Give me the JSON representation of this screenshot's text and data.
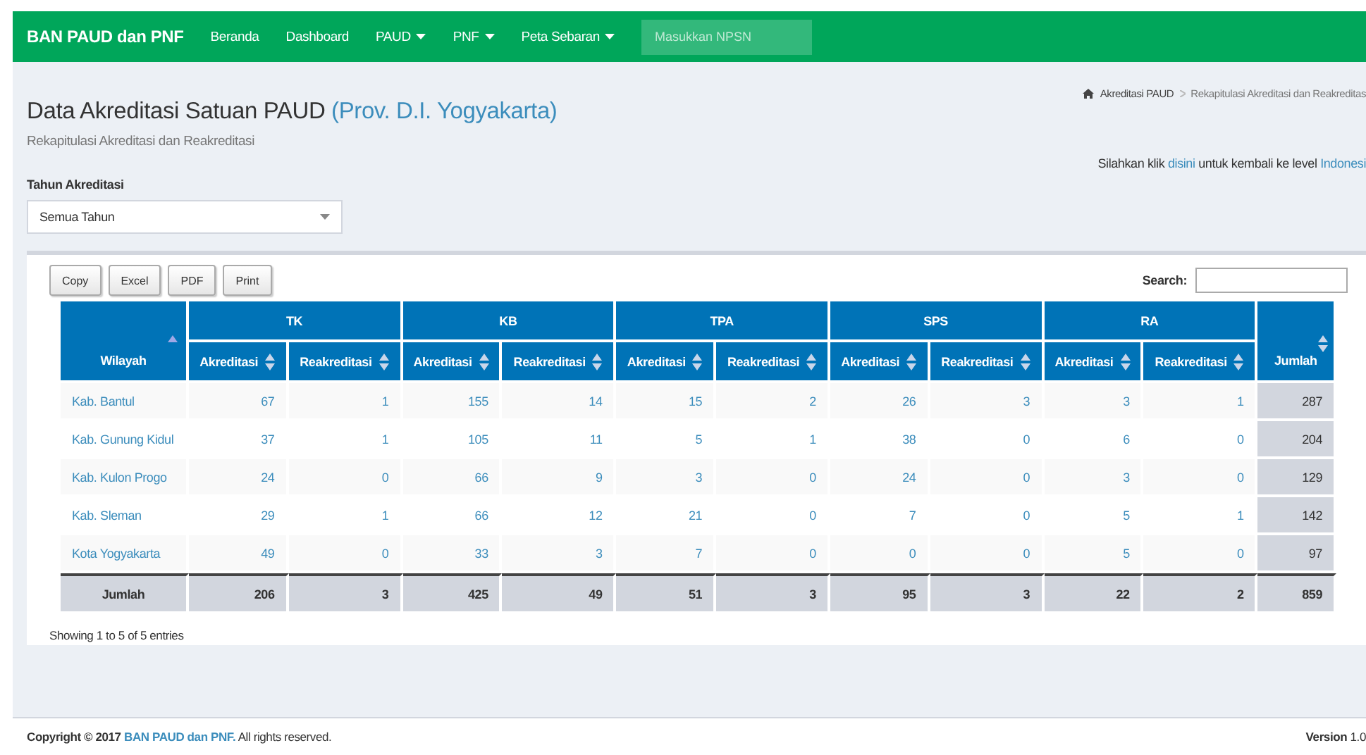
{
  "navbar": {
    "brand": "BAN PAUD dan PNF",
    "items": [
      {
        "label": "Beranda",
        "dropdown": false
      },
      {
        "label": "Dashboard",
        "dropdown": false
      },
      {
        "label": "PAUD",
        "dropdown": true
      },
      {
        "label": "PNF",
        "dropdown": true
      },
      {
        "label": "Peta Sebaran",
        "dropdown": true
      }
    ],
    "search": {
      "placeholder": "Masukkan NPSN"
    }
  },
  "header": {
    "title": "Data Akreditasi Satuan PAUD",
    "title_highlight": "(Prov. D.I. Yogyakarta)",
    "subtitle": "Rekapitulasi Akreditasi dan Reakreditasi"
  },
  "breadcrumb": [
    "Akreditasi PAUD",
    "Rekapitulasi Akreditasi dan Reakreditas"
  ],
  "back_note": {
    "before": "Silahkan klik",
    "link": "disini",
    "middle": "untuk kembali ke level",
    "link2": "Indonesi"
  },
  "filter": {
    "label": "Tahun Akreditasi",
    "value": "Semua Tahun"
  },
  "buttons": [
    "Copy",
    "Excel",
    "PDF",
    "Print"
  ],
  "search": {
    "label": "Search:"
  },
  "table": {
    "first_column": {
      "label": "Wilayah",
      "sorted": true
    },
    "groups": [
      {
        "label": "TK",
        "columns": [
          {
            "label": "Akreditasi",
            "sorted": false
          },
          {
            "label": "Reakreditasi",
            "sorted": false
          }
        ]
      },
      {
        "label": "KB",
        "columns": [
          {
            "label": "Akreditasi",
            "sorted": false
          },
          {
            "label": "Reakreditasi",
            "sorted": false
          }
        ]
      },
      {
        "label": "TPA",
        "columns": [
          {
            "label": "Akreditasi",
            "sorted": false
          },
          {
            "label": "Reakreditasi",
            "sorted": false
          }
        ]
      },
      {
        "label": "SPS",
        "columns": [
          {
            "label": "Akreditasi",
            "sorted": false
          },
          {
            "label": "Reakreditasi",
            "sorted": false
          }
        ]
      },
      {
        "label": "RA",
        "columns": [
          {
            "label": "Akreditasi",
            "sorted": false
          },
          {
            "label": "Reakreditasi",
            "sorted": false
          }
        ]
      }
    ],
    "total_column": {
      "label": "Jumlah",
      "sorted": false
    },
    "rows": [
      {
        "wilayah": "Kab. Bantul",
        "values": [
          "67",
          "1",
          "155",
          "14",
          "15",
          "2",
          "26",
          "3",
          "3",
          "1"
        ],
        "total": "287"
      },
      {
        "wilayah": "Kab. Gunung Kidul",
        "values": [
          "37",
          "1",
          "105",
          "11",
          "5",
          "1",
          "38",
          "0",
          "6",
          "0"
        ],
        "total": "204"
      },
      {
        "wilayah": "Kab. Kulon Progo",
        "values": [
          "24",
          "0",
          "66",
          "9",
          "3",
          "0",
          "24",
          "0",
          "3",
          "0"
        ],
        "total": "129"
      },
      {
        "wilayah": "Kab. Sleman",
        "values": [
          "29",
          "1",
          "66",
          "12",
          "21",
          "0",
          "7",
          "0",
          "5",
          "1"
        ],
        "total": "142"
      },
      {
        "wilayah": "Kota Yogyakarta",
        "values": [
          "49",
          "0",
          "33",
          "3",
          "7",
          "0",
          "0",
          "0",
          "5",
          "0"
        ],
        "total": "97"
      }
    ],
    "footer": {
      "label": "Jumlah",
      "values": [
        "206",
        "3",
        "425",
        "49",
        "51",
        "3",
        "95",
        "3",
        "22",
        "2"
      ],
      "total": "859"
    }
  },
  "info": "Showing 1 to 5 of 5 entries",
  "page_footer": {
    "prefix": "Copyright © 2017",
    "link": "BAN PAUD dan PNF.",
    "suffix": "All rights reserved.",
    "version_label": "Version",
    "version": "1.0"
  }
}
